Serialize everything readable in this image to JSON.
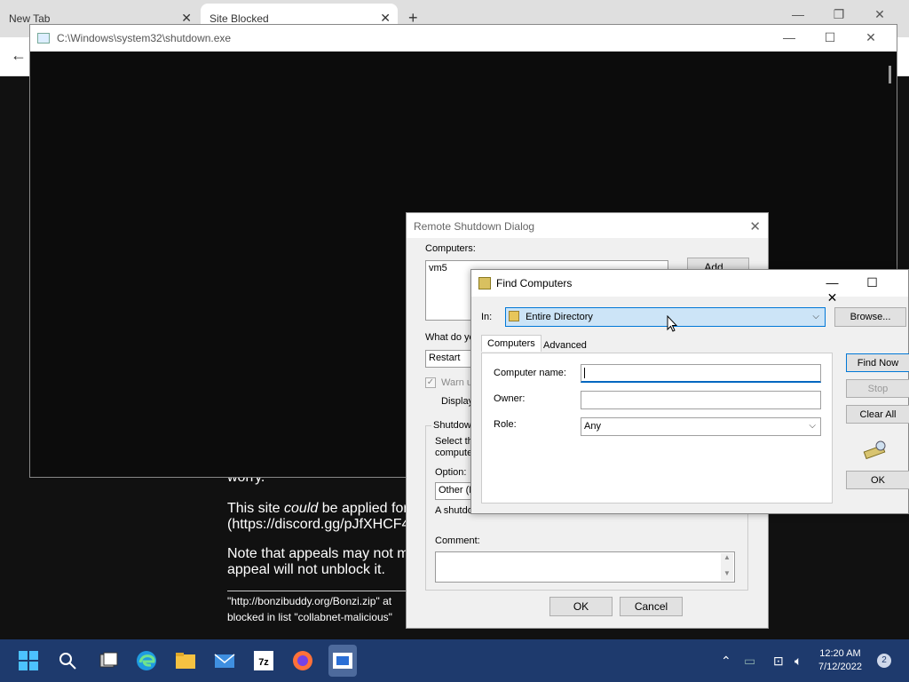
{
  "browser": {
    "tabs": [
      {
        "label": "New Tab"
      },
      {
        "label": "Site Blocked"
      }
    ],
    "new_tab_symbol": "+",
    "close_symbol": "✕",
    "back_symbol": "←",
    "page": {
      "p_worry": "worry.",
      "p_applied_prefix": "This site ",
      "p_applied_em": "could",
      "p_applied_suffix": " be applied for",
      "p_discord": "(https://discord.gg/pJfXHCF4",
      "p_note_line1": "Note that appeals may not m",
      "p_note_line2": "appeal will not unblock it.",
      "p_url_line1": "\"http://bonzibuddy.org/Bonzi.zip\" at",
      "p_url_line2": "blocked in list \"collabnet-malicious\""
    }
  },
  "console": {
    "title": "C:\\Windows\\system32\\shutdown.exe"
  },
  "remote_shutdown": {
    "title": "Remote Shutdown Dialog",
    "computers_label": "Computers:",
    "computers_list": [
      "vm5"
    ],
    "add_button": "Add...",
    "what_label": "What do yo",
    "action_value": "Restart",
    "warn_label": "Warn u",
    "display_label": "Display",
    "shutdown_group": "Shutdow",
    "select_line1": "Select th",
    "select_line2": "compute",
    "option_label": "Option:",
    "option_value": "Other (F",
    "shutdown_desc": "A shutdo",
    "comment_label": "Comment:",
    "ok_button": "OK",
    "cancel_button": "Cancel"
  },
  "find_computers": {
    "title": "Find Computers",
    "in_label": "In:",
    "in_value": "Entire Directory",
    "browse_button": "Browse...",
    "tabs": [
      {
        "label": "Computers"
      },
      {
        "label": "Advanced"
      }
    ],
    "computer_name_label": "Computer name:",
    "owner_label": "Owner:",
    "role_label": "Role:",
    "role_value": "Any",
    "find_now_button": "Find Now",
    "stop_button": "Stop",
    "clear_all_button": "Clear All",
    "ok_button": "OK"
  },
  "taskbar": {
    "time": "12:20 AM",
    "date": "7/12/2022",
    "notification_count": "2",
    "icons": [
      "windows-start-icon",
      "search-icon",
      "task-view-icon",
      "edge-icon",
      "file-explorer-icon",
      "mail-icon",
      "7zip-icon",
      "firefox-icon",
      "app-window-icon"
    ]
  },
  "colors": {
    "taskbar": "#1e3a6d",
    "selection": "#cce4f7",
    "selection_border": "#0078d7",
    "focus_underline": "#0067c0"
  }
}
